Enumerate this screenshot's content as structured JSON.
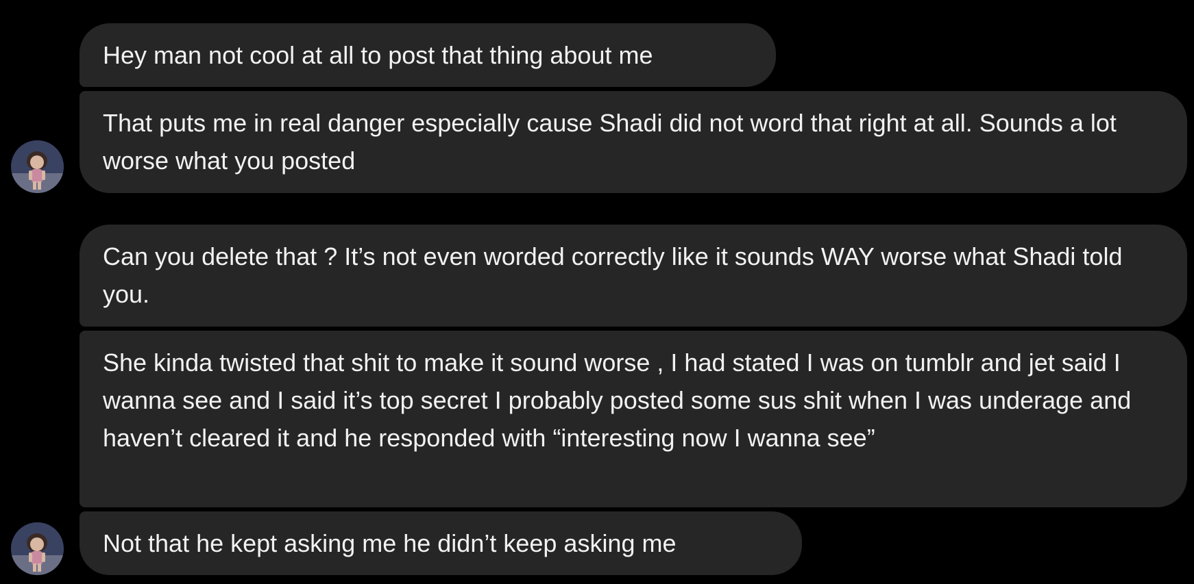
{
  "conversation": {
    "messages": [
      {
        "text": "Hey man not cool at all to post that thing about me"
      },
      {
        "text": "That puts me in real danger especially cause Shadi did not word that right at all. Sounds a lot worse what you posted"
      },
      {
        "text": "Can you delete that ? It’s not even worded correctly like it sounds WAY worse what Shadi told you."
      },
      {
        "text": "She kinda twisted that shit to make it sound worse , I had stated I was on tumblr and jet said I wanna see and I said it’s top secret I probably posted some sus shit when I was underage and haven’t cleared it and he responded with “interesting now I wanna see”"
      },
      {
        "text": "Not that he kept asking me he didn’t keep asking me"
      }
    ],
    "avatar_icon": "contact-avatar-photo"
  },
  "colors": {
    "background": "#000000",
    "bubble": "#262626",
    "text": "#f2f2f2"
  }
}
